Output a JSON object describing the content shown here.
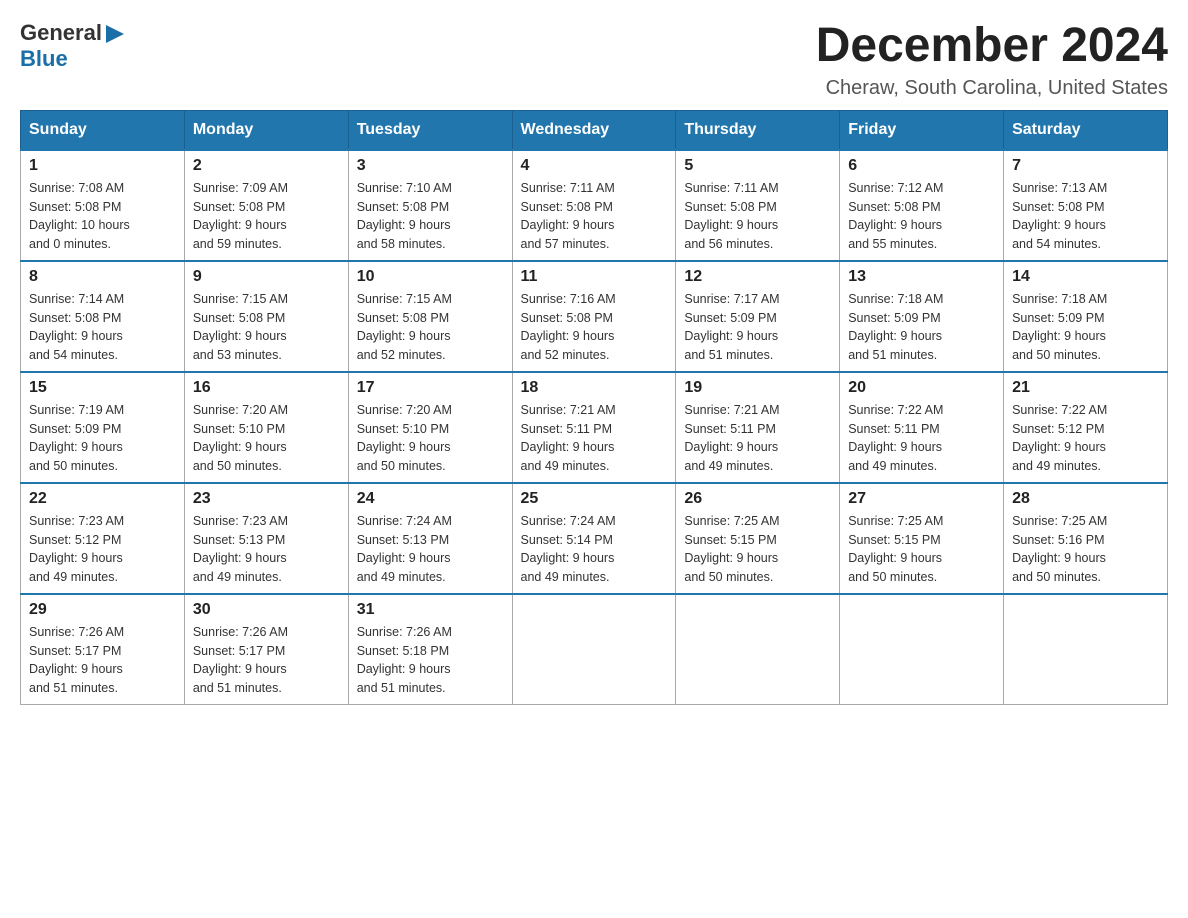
{
  "header": {
    "logo_general": "General",
    "logo_blue": "Blue",
    "month_title": "December 2024",
    "location": "Cheraw, South Carolina, United States"
  },
  "days_of_week": [
    "Sunday",
    "Monday",
    "Tuesday",
    "Wednesday",
    "Thursday",
    "Friday",
    "Saturday"
  ],
  "weeks": [
    [
      {
        "day": "1",
        "sunrise": "7:08 AM",
        "sunset": "5:08 PM",
        "daylight": "10 hours and 0 minutes."
      },
      {
        "day": "2",
        "sunrise": "7:09 AM",
        "sunset": "5:08 PM",
        "daylight": "9 hours and 59 minutes."
      },
      {
        "day": "3",
        "sunrise": "7:10 AM",
        "sunset": "5:08 PM",
        "daylight": "9 hours and 58 minutes."
      },
      {
        "day": "4",
        "sunrise": "7:11 AM",
        "sunset": "5:08 PM",
        "daylight": "9 hours and 57 minutes."
      },
      {
        "day": "5",
        "sunrise": "7:11 AM",
        "sunset": "5:08 PM",
        "daylight": "9 hours and 56 minutes."
      },
      {
        "day": "6",
        "sunrise": "7:12 AM",
        "sunset": "5:08 PM",
        "daylight": "9 hours and 55 minutes."
      },
      {
        "day": "7",
        "sunrise": "7:13 AM",
        "sunset": "5:08 PM",
        "daylight": "9 hours and 54 minutes."
      }
    ],
    [
      {
        "day": "8",
        "sunrise": "7:14 AM",
        "sunset": "5:08 PM",
        "daylight": "9 hours and 54 minutes."
      },
      {
        "day": "9",
        "sunrise": "7:15 AM",
        "sunset": "5:08 PM",
        "daylight": "9 hours and 53 minutes."
      },
      {
        "day": "10",
        "sunrise": "7:15 AM",
        "sunset": "5:08 PM",
        "daylight": "9 hours and 52 minutes."
      },
      {
        "day": "11",
        "sunrise": "7:16 AM",
        "sunset": "5:08 PM",
        "daylight": "9 hours and 52 minutes."
      },
      {
        "day": "12",
        "sunrise": "7:17 AM",
        "sunset": "5:09 PM",
        "daylight": "9 hours and 51 minutes."
      },
      {
        "day": "13",
        "sunrise": "7:18 AM",
        "sunset": "5:09 PM",
        "daylight": "9 hours and 51 minutes."
      },
      {
        "day": "14",
        "sunrise": "7:18 AM",
        "sunset": "5:09 PM",
        "daylight": "9 hours and 50 minutes."
      }
    ],
    [
      {
        "day": "15",
        "sunrise": "7:19 AM",
        "sunset": "5:09 PM",
        "daylight": "9 hours and 50 minutes."
      },
      {
        "day": "16",
        "sunrise": "7:20 AM",
        "sunset": "5:10 PM",
        "daylight": "9 hours and 50 minutes."
      },
      {
        "day": "17",
        "sunrise": "7:20 AM",
        "sunset": "5:10 PM",
        "daylight": "9 hours and 50 minutes."
      },
      {
        "day": "18",
        "sunrise": "7:21 AM",
        "sunset": "5:11 PM",
        "daylight": "9 hours and 49 minutes."
      },
      {
        "day": "19",
        "sunrise": "7:21 AM",
        "sunset": "5:11 PM",
        "daylight": "9 hours and 49 minutes."
      },
      {
        "day": "20",
        "sunrise": "7:22 AM",
        "sunset": "5:11 PM",
        "daylight": "9 hours and 49 minutes."
      },
      {
        "day": "21",
        "sunrise": "7:22 AM",
        "sunset": "5:12 PM",
        "daylight": "9 hours and 49 minutes."
      }
    ],
    [
      {
        "day": "22",
        "sunrise": "7:23 AM",
        "sunset": "5:12 PM",
        "daylight": "9 hours and 49 minutes."
      },
      {
        "day": "23",
        "sunrise": "7:23 AM",
        "sunset": "5:13 PM",
        "daylight": "9 hours and 49 minutes."
      },
      {
        "day": "24",
        "sunrise": "7:24 AM",
        "sunset": "5:13 PM",
        "daylight": "9 hours and 49 minutes."
      },
      {
        "day": "25",
        "sunrise": "7:24 AM",
        "sunset": "5:14 PM",
        "daylight": "9 hours and 49 minutes."
      },
      {
        "day": "26",
        "sunrise": "7:25 AM",
        "sunset": "5:15 PM",
        "daylight": "9 hours and 50 minutes."
      },
      {
        "day": "27",
        "sunrise": "7:25 AM",
        "sunset": "5:15 PM",
        "daylight": "9 hours and 50 minutes."
      },
      {
        "day": "28",
        "sunrise": "7:25 AM",
        "sunset": "5:16 PM",
        "daylight": "9 hours and 50 minutes."
      }
    ],
    [
      {
        "day": "29",
        "sunrise": "7:26 AM",
        "sunset": "5:17 PM",
        "daylight": "9 hours and 51 minutes."
      },
      {
        "day": "30",
        "sunrise": "7:26 AM",
        "sunset": "5:17 PM",
        "daylight": "9 hours and 51 minutes."
      },
      {
        "day": "31",
        "sunrise": "7:26 AM",
        "sunset": "5:18 PM",
        "daylight": "9 hours and 51 minutes."
      },
      null,
      null,
      null,
      null
    ]
  ],
  "labels": {
    "sunrise": "Sunrise:",
    "sunset": "Sunset:",
    "daylight": "Daylight:"
  }
}
